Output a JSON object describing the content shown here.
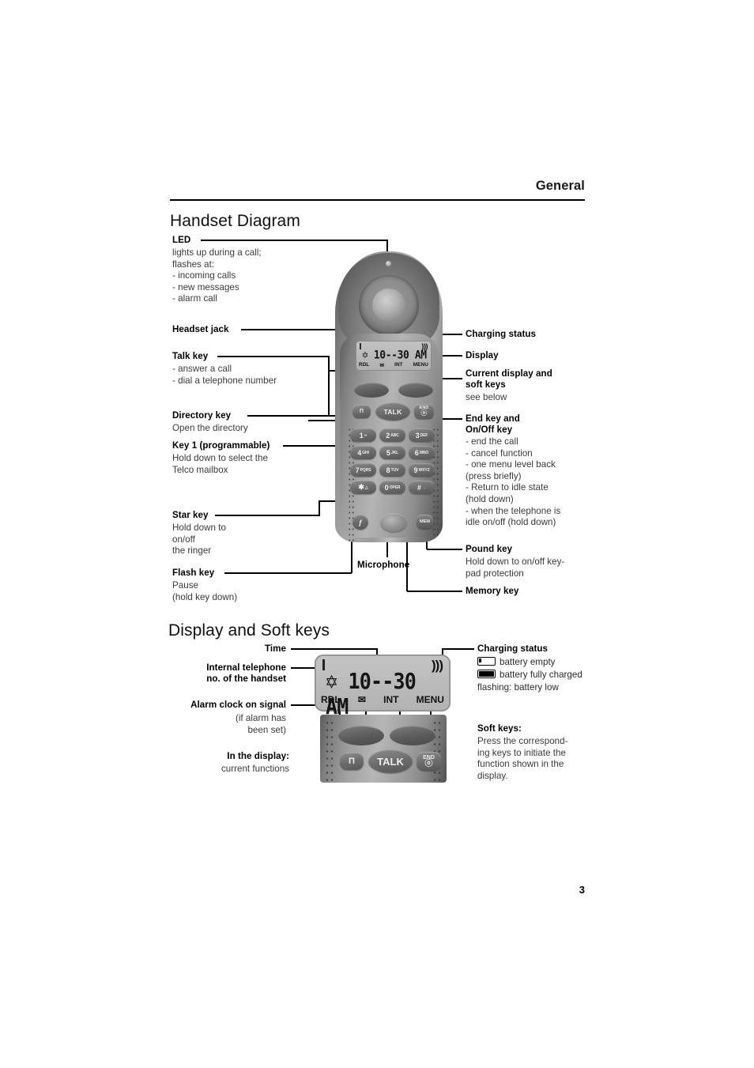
{
  "header": {
    "section": "General",
    "page_number": "3"
  },
  "sections": {
    "handset_diagram": {
      "title": "Handset Diagram",
      "labels": {
        "led": {
          "title": "LED",
          "body": "lights up during a call;\nflashes at:\n- incoming calls\n- new messages\n- alarm call"
        },
        "headset_jack": {
          "title": "Headset jack"
        },
        "talk_key": {
          "title": "Talk key",
          "body": "- answer a call\n- dial a telephone number"
        },
        "directory_key": {
          "title": "Directory key",
          "body": "Open the directory"
        },
        "key1": {
          "title": "Key 1 (programmable)",
          "body": "Hold down to select the\nTelco mailbox"
        },
        "star_key": {
          "title": "Star key",
          "body": "Hold down to\non/off\nthe ringer"
        },
        "flash_key": {
          "title": "Flash key",
          "body": "Pause\n(hold key down)"
        },
        "microphone": {
          "title": "Microphone"
        },
        "charging_status": {
          "title": "Charging status"
        },
        "display": {
          "title": "Display"
        },
        "current_display": {
          "title": "Current display and\nsoft keys",
          "body": "see below"
        },
        "end_key": {
          "title": "End key and\nOn/Off key",
          "body": "- end the call\n- cancel function\n- one menu level back\n  (press briefly)\n- Return to idle state\n  (hold down)\n- when the telephone is\n  idle on/off  (hold down)"
        },
        "pound_key": {
          "title": "Pound key",
          "body": "Hold down to on/off key-\npad protection"
        },
        "memory_key": {
          "title": "Memory key"
        }
      }
    },
    "display_soft_keys": {
      "title": "Display and Soft keys",
      "labels": {
        "time": {
          "title": "Time"
        },
        "internal_no": {
          "title": "Internal telephone\nno. of the handset"
        },
        "alarm_signal": {
          "title": "Alarm clock on signal",
          "body": "(if alarm has\nbeen set)"
        },
        "in_the_display": {
          "title": "In the display:",
          "body": "current functions"
        },
        "charging_status": {
          "title": "Charging status",
          "battery_empty": "battery empty",
          "battery_full": "battery fully charged",
          "flashing": "flashing: battery low"
        },
        "soft_keys": {
          "title": "Soft keys:",
          "body": "Press the correspond-\ning keys to initiate the\nfunction shown in the\ndisplay."
        }
      }
    }
  },
  "handset": {
    "lcd": {
      "time": "10--30 AM",
      "alarm_glyph": "✡",
      "antenna_glyph": ")))",
      "softkeys": [
        "RDL",
        "✉",
        "INT",
        "MENU"
      ]
    },
    "keys": {
      "directory": "Π",
      "talk": "TALK",
      "end_top": "END",
      "end_sym": "ⓞ",
      "numbers": [
        {
          "big": "1",
          "sml": "∞"
        },
        {
          "big": "2",
          "sml": "ABC"
        },
        {
          "big": "3",
          "sml": "DEF"
        },
        {
          "big": "4",
          "sml": "GHI"
        },
        {
          "big": "5",
          "sml": "JKL"
        },
        {
          "big": "6",
          "sml": "MNO"
        },
        {
          "big": "7",
          "sml": "PQRS"
        },
        {
          "big": "8",
          "sml": "TUV"
        },
        {
          "big": "9",
          "sml": "WXYZ"
        },
        {
          "big": "✱",
          "sml": "△"
        },
        {
          "big": "0",
          "sml": "OPER"
        },
        {
          "big": "#",
          "sml": "→"
        }
      ],
      "flash": "ƒ",
      "memory": "MEM"
    }
  },
  "colors": {
    "ink": "#000000",
    "body_text": "#3a3a3a",
    "rule": "#000000"
  }
}
